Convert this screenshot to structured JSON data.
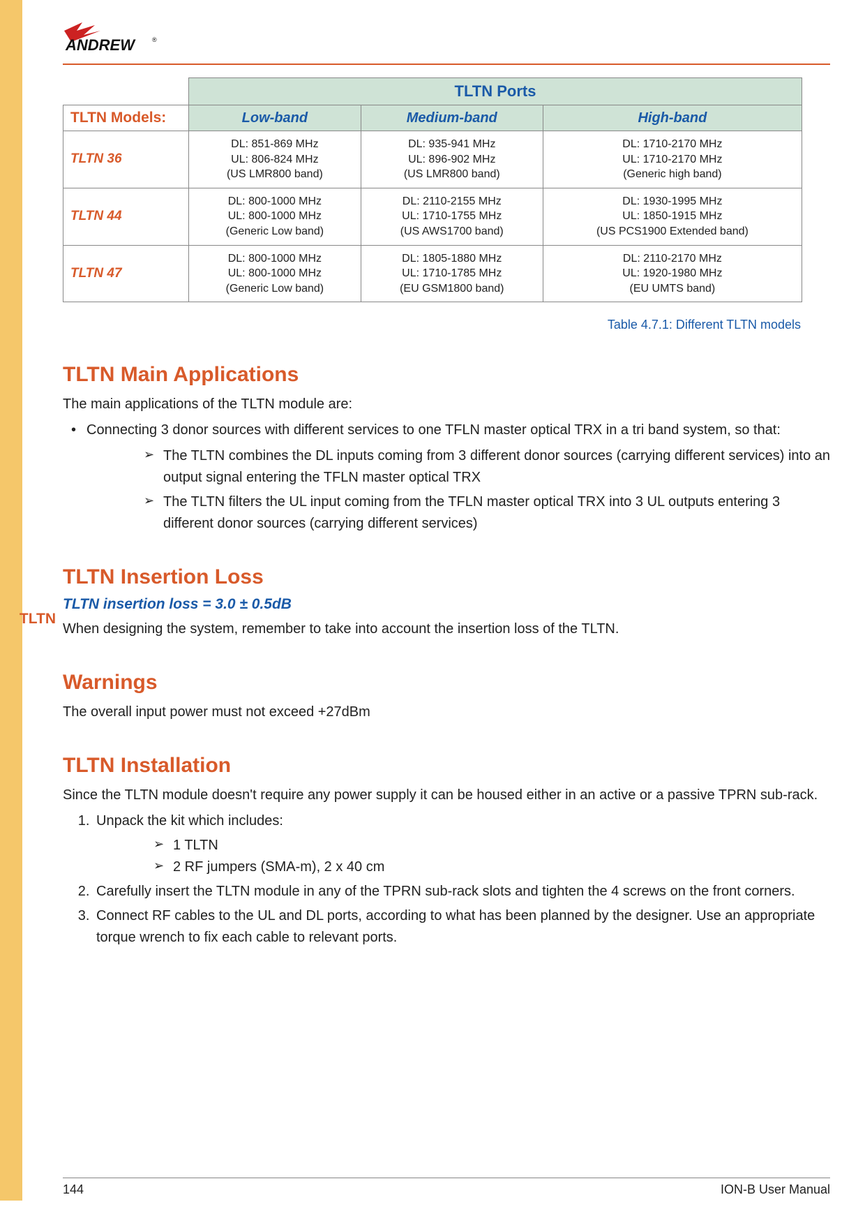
{
  "side_tab": "TLTN",
  "logo_text": "ANDREW",
  "table": {
    "ports_header": "TLTN Ports",
    "models_header": "TLTN Models:",
    "band_headers": [
      "Low-band",
      "Medium-band",
      "High-band"
    ],
    "rows": [
      {
        "model": "TLTN 36",
        "low": {
          "dl": "DL: 851-869 MHz",
          "ul": "UL: 806-824 MHz",
          "note": "(US LMR800 band)"
        },
        "med": {
          "dl": "DL: 935-941 MHz",
          "ul": "UL: 896-902 MHz",
          "note": "(US LMR800 band)"
        },
        "high": {
          "dl": "DL: 1710-2170 MHz",
          "ul": "UL: 1710-2170 MHz",
          "note": "(Generic high band)"
        }
      },
      {
        "model": "TLTN 44",
        "low": {
          "dl": "DL: 800-1000 MHz",
          "ul": "UL: 800-1000 MHz",
          "note": "(Generic Low band)"
        },
        "med": {
          "dl": "DL: 2110-2155 MHz",
          "ul": "UL: 1710-1755 MHz",
          "note": "(US AWS1700 band)"
        },
        "high": {
          "dl": "DL: 1930-1995 MHz",
          "ul": "UL: 1850-1915 MHz",
          "note": "(US PCS1900 Extended band)"
        }
      },
      {
        "model": "TLTN 47",
        "low": {
          "dl": "DL: 800-1000 MHz",
          "ul": "UL: 800-1000 MHz",
          "note": "(Generic Low band)"
        },
        "med": {
          "dl": "DL: 1805-1880 MHz",
          "ul": "UL: 1710-1785 MHz",
          "note": "(EU GSM1800 band)"
        },
        "high": {
          "dl": "DL: 2110-2170 MHz",
          "ul": "UL: 1920-1980 MHz",
          "note": "(EU UMTS band)"
        }
      }
    ],
    "caption": "Table 4.7.1: Different TLTN models"
  },
  "sections": {
    "main_apps": {
      "heading": "TLTN Main Applications",
      "intro": "The main applications of the TLTN module are:",
      "bullet": "Connecting 3 donor sources with different services to one TFLN master optical TRX in a tri band system, so that:",
      "sub1": "The TLTN combines the DL inputs coming from 3 different donor sources (carrying different services) into an output signal entering the TFLN master optical TRX",
      "sub2": "The TLTN filters the UL input coming from the TFLN master optical TRX into 3 UL outputs entering 3 different donor sources (carrying different services)"
    },
    "insertion": {
      "heading": "TLTN Insertion Loss",
      "sub": "TLTN insertion loss = 3.0 ± 0.5dB",
      "text": "When designing the system, remember to take into account the insertion loss of the TLTN."
    },
    "warnings": {
      "heading": "Warnings",
      "text": "The overall input power must not exceed +27dBm"
    },
    "install": {
      "heading": "TLTN Installation",
      "intro": "Since the TLTN module doesn't require any power supply it can be housed either in an active or a passive TPRN sub-rack.",
      "step1": "Unpack the kit which includes:",
      "step1a": "1 TLTN",
      "step1b": "2 RF jumpers (SMA-m), 2 x 40 cm",
      "step2": "Carefully insert the TLTN module in any of the TPRN sub-rack slots and tighten the 4 screws on the front corners.",
      "step3": "Connect RF cables to the UL and DL ports, according to what has been planned by the designer. Use an appropriate torque wrench to fix each cable to relevant ports."
    }
  },
  "footer": {
    "page": "144",
    "title": "ION-B User Manual"
  }
}
